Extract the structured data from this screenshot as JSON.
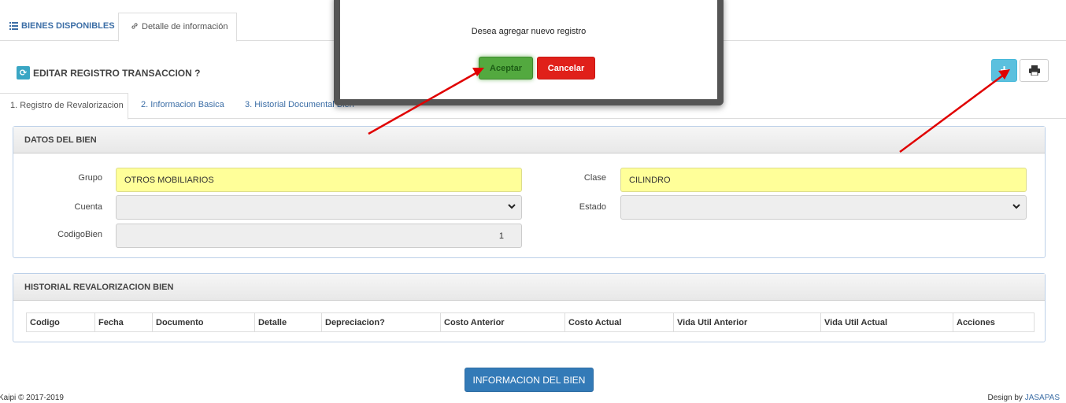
{
  "tabs": {
    "bienes_disponibles": "BIENES DISPONIBLES",
    "detalle_informacion": "Detalle de información"
  },
  "page": {
    "title": "EDITAR REGISTRO TRANSACCION ?"
  },
  "toolbar": {
    "add_icon": "plus-icon",
    "print_icon": "print-icon"
  },
  "sub_tabs": [
    "1. Registro de Revalorizacion",
    "2. Informacion Basica",
    "3. Historial Documental Bien"
  ],
  "datos_bien": {
    "heading": "DATOS DEL BIEN",
    "grupo_label": "Grupo",
    "grupo_value": "OTROS MOBILIARIOS",
    "cuenta_label": "Cuenta",
    "cuenta_value": "",
    "codigo_label": "CodigoBien",
    "codigo_value": "1",
    "clase_label": "Clase",
    "clase_value": "CILINDRO",
    "estado_label": "Estado",
    "estado_value": ""
  },
  "historial": {
    "heading": "HISTORIAL REVALORIZACION BIEN",
    "columns": [
      "Codigo",
      "Fecha",
      "Documento",
      "Detalle",
      "Depreciacion?",
      "Costo Anterior",
      "Costo Actual",
      "Vida Util Anterior",
      "Vida Util Actual",
      "Acciones"
    ]
  },
  "buttons": {
    "informacion_bien": "INFORMACION DEL BIEN"
  },
  "footer": {
    "copyright": "Kaipi © 2017-2019",
    "design_by": "Design by ",
    "design_link": "JASAPAS"
  },
  "modal": {
    "message": "Desea agregar nuevo registro",
    "accept": "Aceptar",
    "cancel": "Cancelar"
  },
  "colors": {
    "accent": "#337ab7",
    "info": "#5bc0de",
    "field_highlight": "#ffff99",
    "accept": "#53a93f",
    "cancel": "#e0201a",
    "annotation_arrow": "#e00000"
  }
}
